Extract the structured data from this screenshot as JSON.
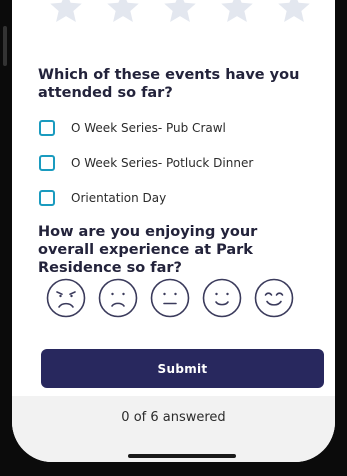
{
  "rating": {
    "stars": 5,
    "selected": 0
  },
  "events_question": {
    "text": "Which of these events have you attended so far?",
    "options": [
      {
        "label": "O Week Series- Pub Crawl",
        "checked": false
      },
      {
        "label": "O Week Series- Potluck Dinner",
        "checked": false
      },
      {
        "label": "Orientation Day",
        "checked": false
      }
    ]
  },
  "experience_question": {
    "text": "How are you enjoying your overall experience at Park Residence so far?",
    "faces": [
      "very-sad-face-icon",
      "sad-face-icon",
      "neutral-face-icon",
      "happy-face-icon",
      "very-happy-face-icon"
    ]
  },
  "submit": {
    "label": "Submit"
  },
  "footer": {
    "progress": "0 of 6 answered"
  },
  "colors": {
    "accent": "#1a9bbf",
    "button": "#28285e",
    "star": "#e3e7ef",
    "face_stroke": "#3b3b5c"
  }
}
